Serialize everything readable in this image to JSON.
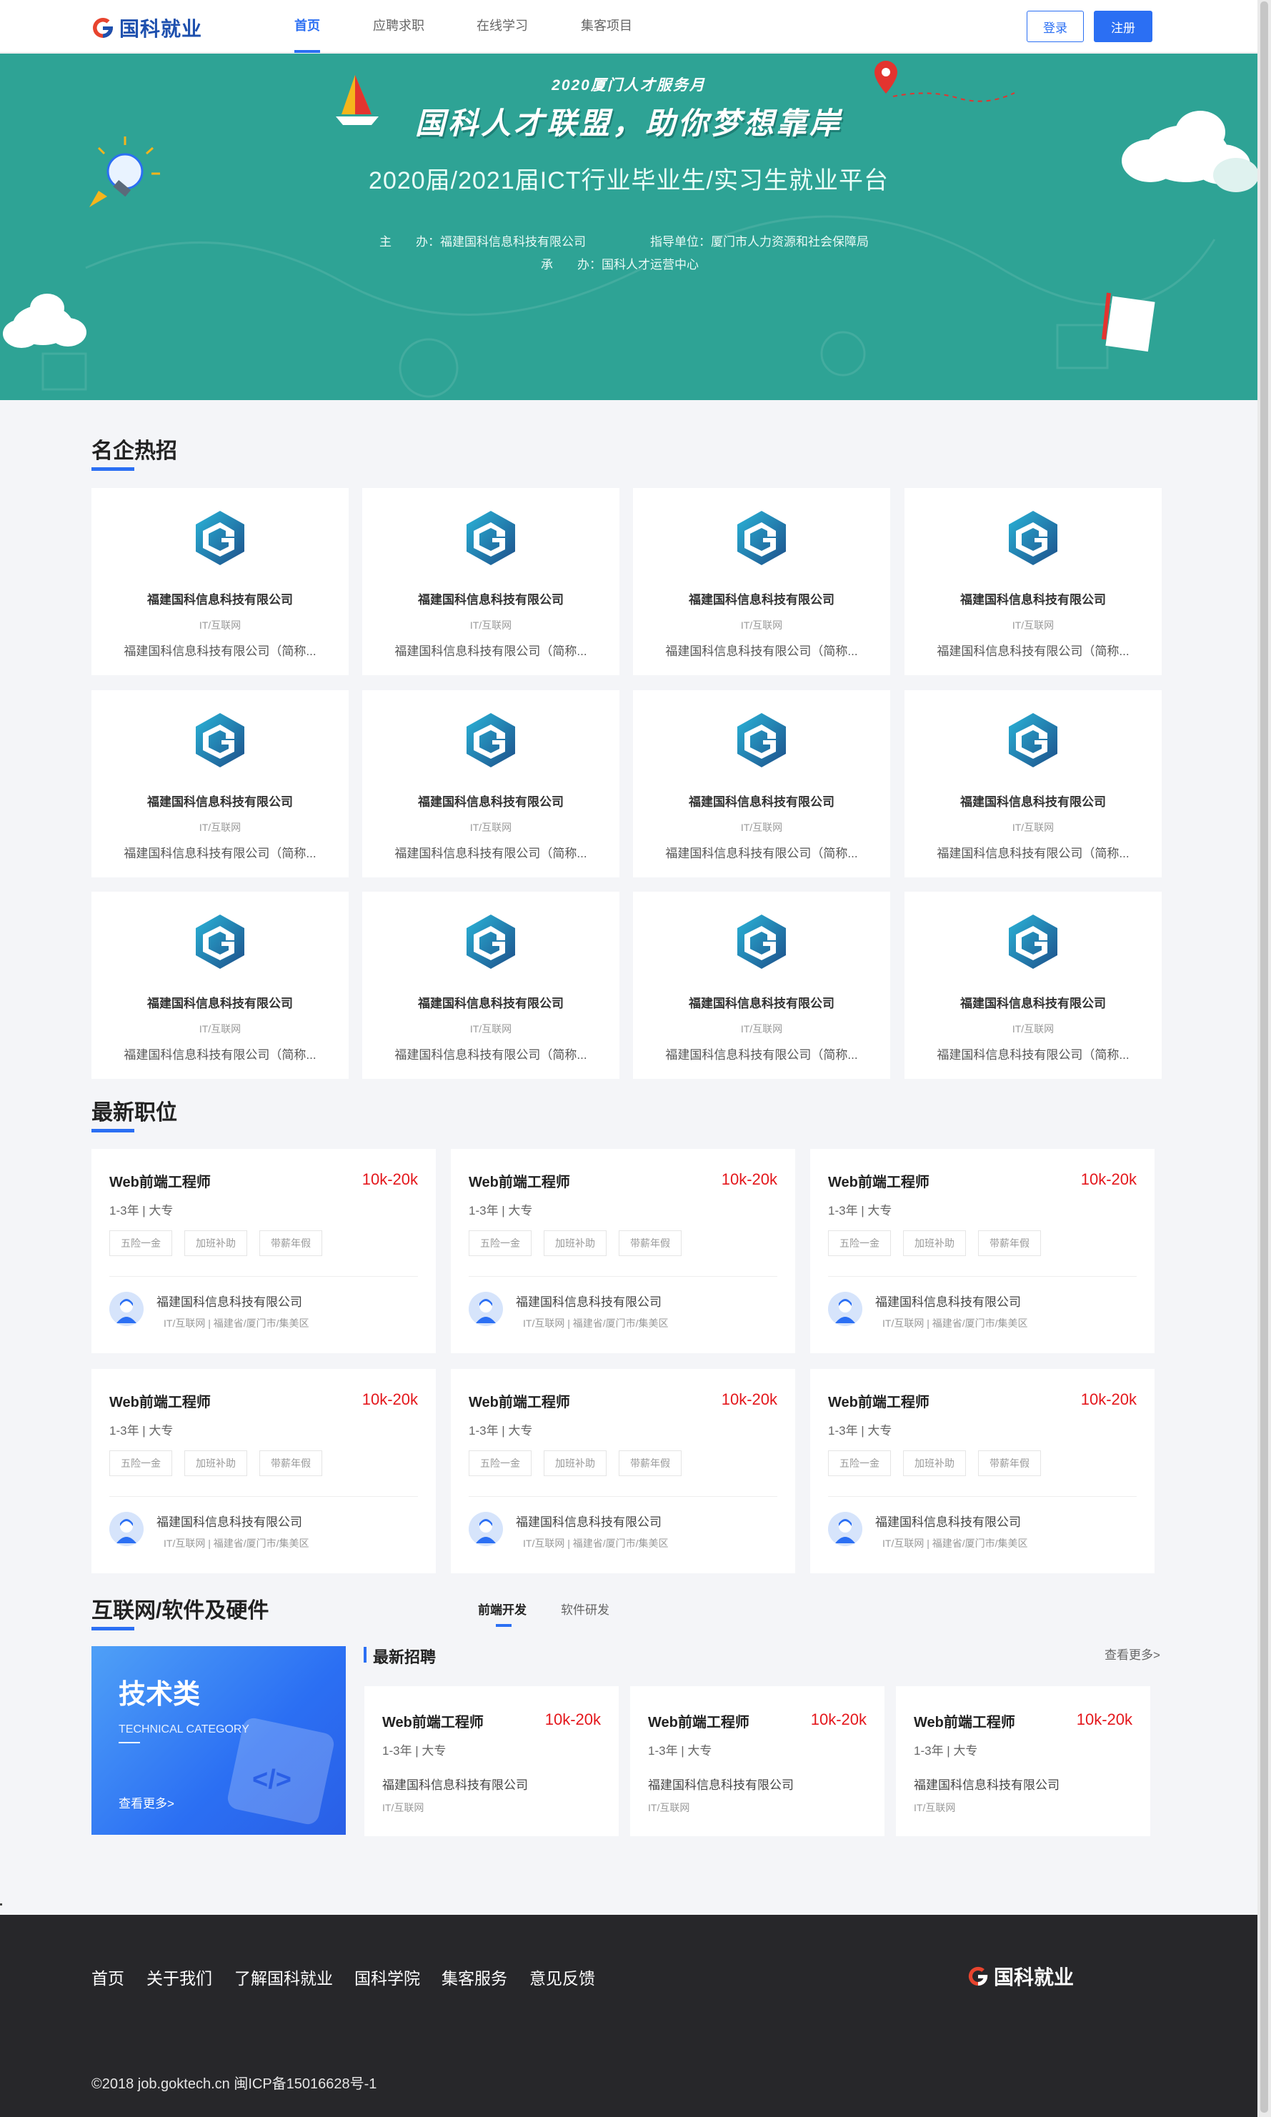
{
  "colors": {
    "primary": "#2b6ff3",
    "salary": "#e4171c",
    "banner_bg": "#2ea395",
    "footer_bg": "#27272a"
  },
  "header": {
    "logo_text": "国科就业",
    "nav": [
      "首页",
      "应聘求职",
      "在线学习",
      "集客项目"
    ],
    "active_nav": "首页",
    "login_label": "登录",
    "register_label": "注册"
  },
  "banner": {
    "subtitle": "2020厦门人才服务月",
    "title": "国科人才联盟，助你梦想靠岸",
    "headline": "2020届/2021届ICT行业毕业生/实习生就业平台",
    "host": "主　　办：福建国科信息科技有限公司",
    "guide": "指导单位：厦门市人力资源和社会保障局",
    "organizer": "承　　办：国科人才运营中心"
  },
  "hot_companies": {
    "title": "名企热招",
    "items": [
      {
        "name": "福建国科信息科技有限公司",
        "industry": "IT/互联网",
        "desc": "福建国科信息科技有限公司（简称..."
      },
      {
        "name": "福建国科信息科技有限公司",
        "industry": "IT/互联网",
        "desc": "福建国科信息科技有限公司（简称..."
      },
      {
        "name": "福建国科信息科技有限公司",
        "industry": "IT/互联网",
        "desc": "福建国科信息科技有限公司（简称..."
      },
      {
        "name": "福建国科信息科技有限公司",
        "industry": "IT/互联网",
        "desc": "福建国科信息科技有限公司（简称..."
      },
      {
        "name": "福建国科信息科技有限公司",
        "industry": "IT/互联网",
        "desc": "福建国科信息科技有限公司（简称..."
      },
      {
        "name": "福建国科信息科技有限公司",
        "industry": "IT/互联网",
        "desc": "福建国科信息科技有限公司（简称..."
      },
      {
        "name": "福建国科信息科技有限公司",
        "industry": "IT/互联网",
        "desc": "福建国科信息科技有限公司（简称..."
      },
      {
        "name": "福建国科信息科技有限公司",
        "industry": "IT/互联网",
        "desc": "福建国科信息科技有限公司（简称..."
      },
      {
        "name": "福建国科信息科技有限公司",
        "industry": "IT/互联网",
        "desc": "福建国科信息科技有限公司（简称..."
      },
      {
        "name": "福建国科信息科技有限公司",
        "industry": "IT/互联网",
        "desc": "福建国科信息科技有限公司（简称..."
      },
      {
        "name": "福建国科信息科技有限公司",
        "industry": "IT/互联网",
        "desc": "福建国科信息科技有限公司（简称..."
      },
      {
        "name": "福建国科信息科技有限公司",
        "industry": "IT/互联网",
        "desc": "福建国科信息科技有限公司（简称..."
      }
    ]
  },
  "latest_jobs": {
    "title": "最新职位",
    "items": [
      {
        "title": "Web前端工程师",
        "salary": "10k-20k",
        "meta": "1-3年 | 大专",
        "tags": [
          "五险一金",
          "加班补助",
          "带薪年假"
        ],
        "company": "福建国科信息科技有限公司",
        "company_info": "IT/互联网 | 福建省/厦门市/集美区"
      },
      {
        "title": "Web前端工程师",
        "salary": "10k-20k",
        "meta": "1-3年 | 大专",
        "tags": [
          "五险一金",
          "加班补助",
          "带薪年假"
        ],
        "company": "福建国科信息科技有限公司",
        "company_info": "IT/互联网 | 福建省/厦门市/集美区"
      },
      {
        "title": "Web前端工程师",
        "salary": "10k-20k",
        "meta": "1-3年 | 大专",
        "tags": [
          "五险一金",
          "加班补助",
          "带薪年假"
        ],
        "company": "福建国科信息科技有限公司",
        "company_info": "IT/互联网 | 福建省/厦门市/集美区"
      },
      {
        "title": "Web前端工程师",
        "salary": "10k-20k",
        "meta": "1-3年 | 大专",
        "tags": [
          "五险一金",
          "加班补助",
          "带薪年假"
        ],
        "company": "福建国科信息科技有限公司",
        "company_info": "IT/互联网 | 福建省/厦门市/集美区"
      },
      {
        "title": "Web前端工程师",
        "salary": "10k-20k",
        "meta": "1-3年 | 大专",
        "tags": [
          "五险一金",
          "加班补助",
          "带薪年假"
        ],
        "company": "福建国科信息科技有限公司",
        "company_info": "IT/互联网 | 福建省/厦门市/集美区"
      },
      {
        "title": "Web前端工程师",
        "salary": "10k-20k",
        "meta": "1-3年 | 大专",
        "tags": [
          "五险一金",
          "加班补助",
          "带薪年假"
        ],
        "company": "福建国科信息科技有限公司",
        "company_info": "IT/互联网 | 福建省/厦门市/集美区"
      }
    ]
  },
  "internet": {
    "title": "互联网/软件及硬件",
    "tabs": [
      "前端开发",
      "软件研发"
    ],
    "active_tab": "前端开发",
    "promo": {
      "title": "技术类",
      "subtitle": "TECHNICAL CATEGORY",
      "more": "查看更多>",
      "code_icon_text": "</>"
    },
    "recent_title": "最新招聘",
    "more": "查看更多>",
    "items": [
      {
        "title": "Web前端工程师",
        "salary": "10k-20k",
        "meta": "1-3年 | 大专",
        "company": "福建国科信息科技有限公司",
        "industry": "IT/互联网"
      },
      {
        "title": "Web前端工程师",
        "salary": "10k-20k",
        "meta": "1-3年 | 大专",
        "company": "福建国科信息科技有限公司",
        "industry": "IT/互联网"
      },
      {
        "title": "Web前端工程师",
        "salary": "10k-20k",
        "meta": "1-3年 | 大专",
        "company": "福建国科信息科技有限公司",
        "industry": "IT/互联网"
      }
    ]
  },
  "footer": {
    "links": [
      "首页",
      "关于我们",
      "了解国科就业",
      "国科学院",
      "集客服务",
      "意见反馈"
    ],
    "logo_text": "国科就业",
    "copyright": "©2018 job.goktech.cn 闽ICP备15016628号-1"
  }
}
